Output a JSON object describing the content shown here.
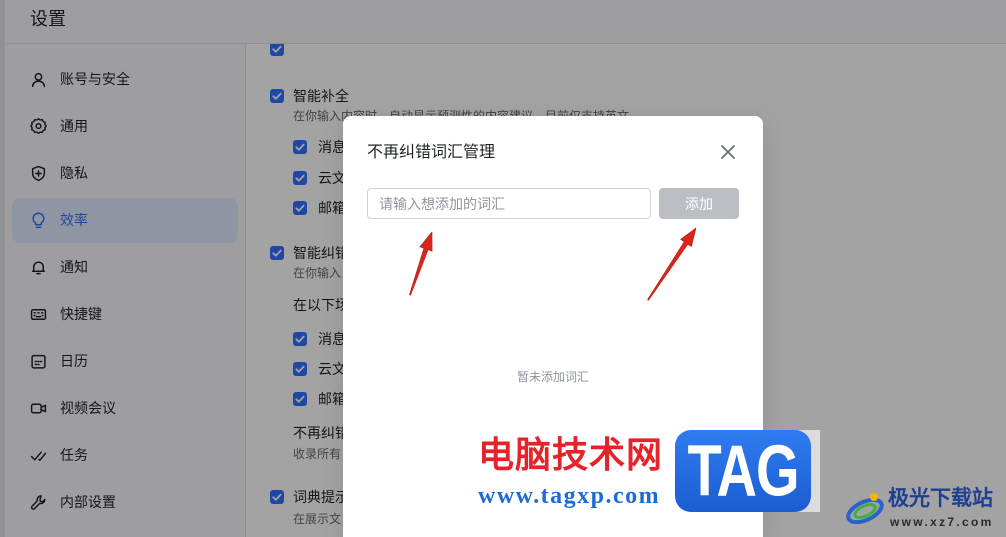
{
  "window": {
    "title": "设置"
  },
  "sidebar": {
    "items": [
      {
        "label": "账号与安全",
        "icon": "user-icon",
        "selected": false
      },
      {
        "label": "通用",
        "icon": "gear-icon",
        "selected": false
      },
      {
        "label": "隐私",
        "icon": "shield-icon",
        "selected": false
      },
      {
        "label": "效率",
        "icon": "lightbulb-icon",
        "selected": true
      },
      {
        "label": "通知",
        "icon": "bell-icon",
        "selected": false
      },
      {
        "label": "快捷键",
        "icon": "keyboard-icon",
        "selected": false
      },
      {
        "label": "日历",
        "icon": "calendar-icon",
        "selected": false
      },
      {
        "label": "视频会议",
        "icon": "video-icon",
        "selected": false
      },
      {
        "label": "任务",
        "icon": "task-check-icon",
        "selected": false
      },
      {
        "label": "内部设置",
        "icon": "wrench-icon",
        "selected": false
      }
    ]
  },
  "settings": {
    "clipped_top": {
      "checked": true
    },
    "smart_complete": {
      "label": "智能补全",
      "checked": true,
      "description": "在你输入内容时，自动显示预测性的内容建议，目前仅支持英文",
      "options": [
        {
          "label": "消息",
          "checked": true
        },
        {
          "label": "云文",
          "checked": true
        },
        {
          "label": "邮箱",
          "checked": true
        }
      ]
    },
    "smart_correct": {
      "label": "智能纠错",
      "checked": true,
      "description": "在你输入",
      "scenes_label": "在以下场",
      "options": [
        {
          "label": "消息",
          "checked": true
        },
        {
          "label": "云文",
          "checked": true
        },
        {
          "label": "邮箱",
          "checked": true
        }
      ]
    },
    "no_correct": {
      "label": "不再纠错",
      "description": "收录所有"
    },
    "dictionary_hint": {
      "label": "词典提示",
      "checked": true,
      "description": "在展示文"
    }
  },
  "dialog": {
    "title": "不再纠错词汇管理",
    "input_placeholder": "请输入想添加的词汇",
    "add_label": "添加",
    "empty_text": "暂未添加词汇"
  },
  "watermarks": {
    "site_name": "电脑技术网",
    "site_url": "www.tagxp.com",
    "logo_text": "TAG",
    "brand_name": "极光下载站",
    "brand_url": "www.xz7.com"
  },
  "colors": {
    "accent": "#3370ff",
    "button_disabled": "#bbbfc4",
    "annotation_arrow": "#d9261c",
    "watermark_red": "#e5232b",
    "watermark_blue": "#1c6bd6"
  }
}
